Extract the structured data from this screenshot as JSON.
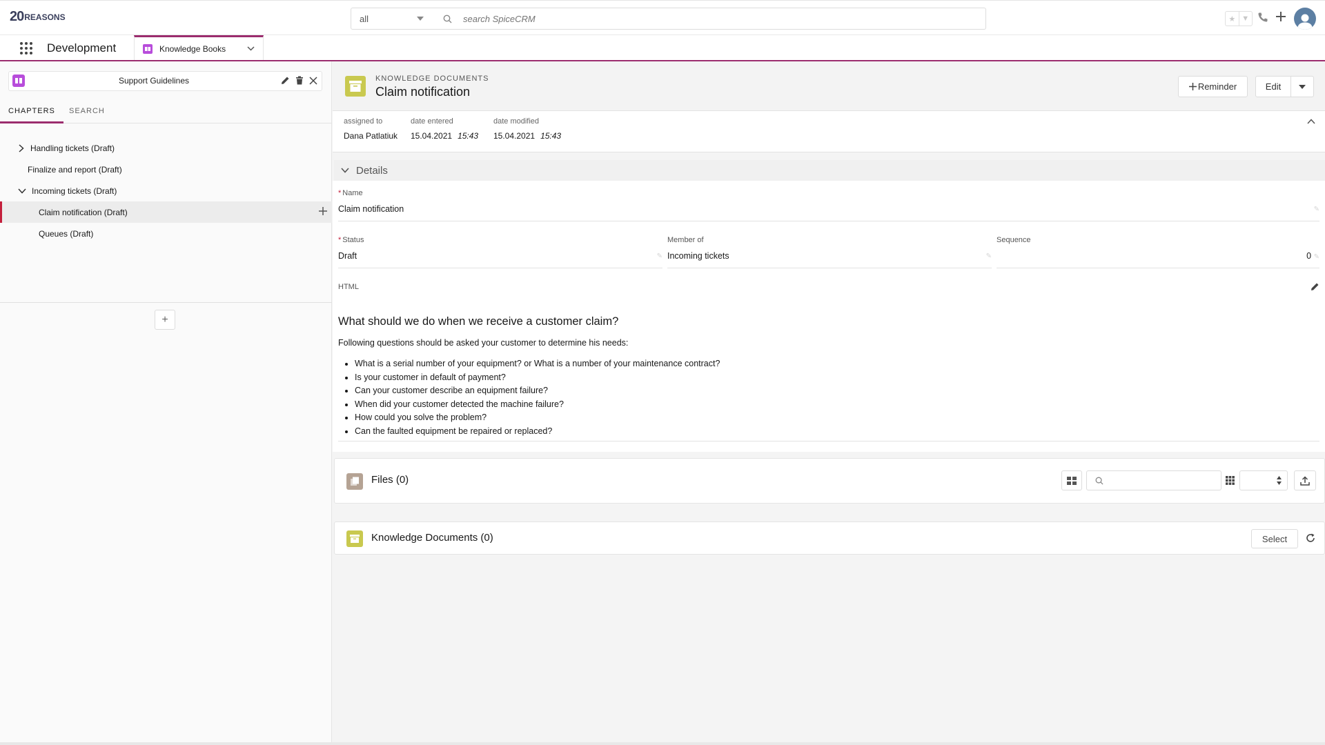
{
  "topbar": {
    "logo_mark": "20",
    "logo_word": "REASONS",
    "scope_value": "all",
    "search_placeholder": "search SpiceCRM"
  },
  "nav": {
    "app_title": "Development",
    "tab_label": "Knowledge Books"
  },
  "left": {
    "book_name": "Support Guidelines",
    "tabs": [
      "CHAPTERS",
      "SEARCH"
    ],
    "tree": [
      {
        "label": "Handling tickets (Draft)",
        "level": 0,
        "expanded": false
      },
      {
        "label": "Finalize and report (Draft)",
        "level": 0,
        "expanded": null
      },
      {
        "label": "Incoming tickets (Draft)",
        "level": 0,
        "expanded": true
      },
      {
        "label": "Claim notification (Draft)",
        "level": 1,
        "selected": true
      },
      {
        "label": "Queues (Draft)",
        "level": 1
      }
    ]
  },
  "record": {
    "module": "KNOWLEDGE DOCUMENTS",
    "title": "Claim notification",
    "reminder_label": "Reminder",
    "edit_label": "Edit"
  },
  "meta": {
    "assigned_label": "assigned to",
    "assigned_value": "Dana Patlatiuk",
    "entered_label": "date entered",
    "entered_date": "15.04.2021",
    "entered_time": "15:43",
    "modified_label": "date modified",
    "modified_date": "15.04.2021",
    "modified_time": "15:43"
  },
  "details": {
    "section_label": "Details",
    "name_label": "Name",
    "name_value": "Claim notification",
    "status_label": "Status",
    "status_value": "Draft",
    "member_label": "Member of",
    "member_value": "Incoming tickets",
    "sequence_label": "Sequence",
    "sequence_value": "0",
    "html_label": "HTML"
  },
  "html_content": {
    "heading": "What should we do when we receive a customer claim?",
    "intro": "Following questions should be asked your customer to determine his needs:",
    "items": [
      "What is a serial number of your equipment?  or What is a number of your maintenance contract?",
      "Is your customer in default of payment?",
      "Can your customer describe an equipment failure?",
      "When did your customer detected the machine failure?",
      "How could you solve the problem?",
      "Can the faulted equipment be repaired or replaced?"
    ]
  },
  "files": {
    "title": "Files (0)"
  },
  "knowledge_docs": {
    "title": "Knowledge Documents (0)",
    "select_label": "Select"
  },
  "colors": {
    "accent": "#9b2c6e",
    "selected_marker": "#c41f3c",
    "doc_icon": "#c9c94f",
    "book_icon": "#b84ddb",
    "files_icon": "#b5a394",
    "avatar": "#5c7fa3"
  }
}
